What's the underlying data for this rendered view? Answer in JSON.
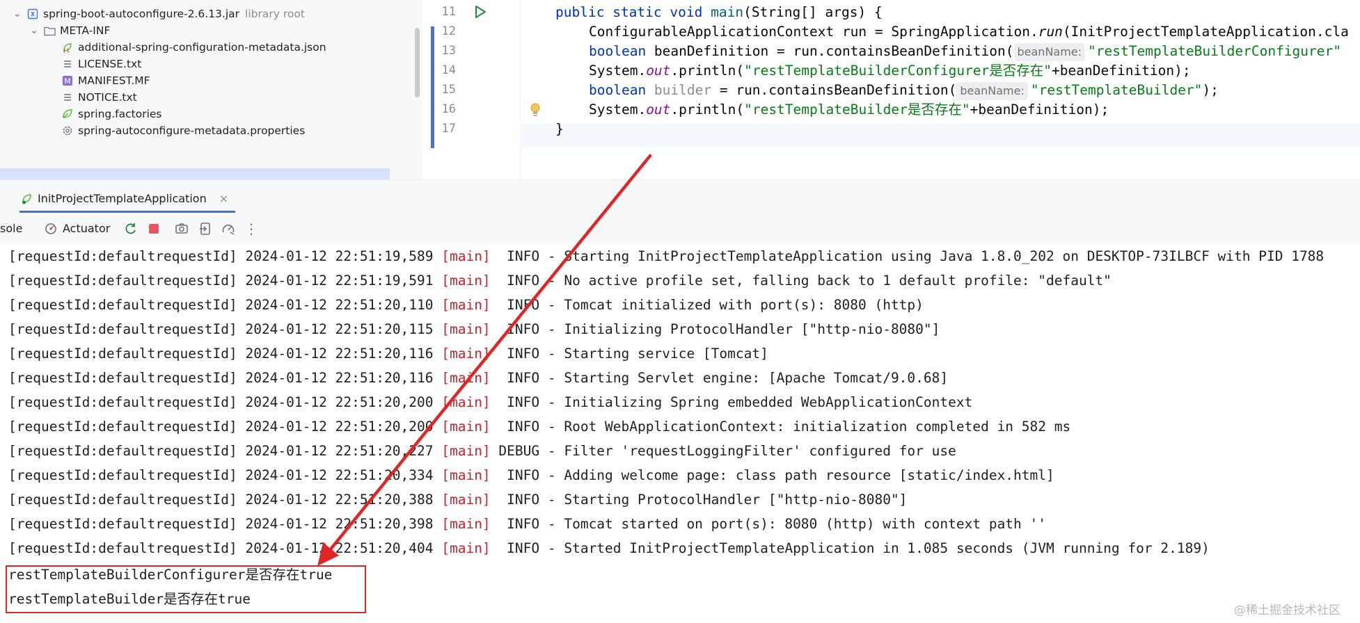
{
  "project_tree": {
    "items": [
      {
        "label": "spring-boot-autoconfigure-2.6.13.jar",
        "secondary": "library root",
        "icon": "jar-archive-icon",
        "expanded": true
      },
      {
        "label": "META-INF",
        "icon": "folder-icon",
        "expanded": true
      },
      {
        "label": "additional-spring-configuration-metadata.json",
        "icon": "spring-json-icon"
      },
      {
        "label": "LICENSE.txt",
        "icon": "text-file-icon"
      },
      {
        "label": "MANIFEST.MF",
        "icon": "manifest-file-icon"
      },
      {
        "label": "NOTICE.txt",
        "icon": "text-file-icon"
      },
      {
        "label": "spring.factories",
        "icon": "spring-leaf-icon"
      },
      {
        "label": "spring-autoconfigure-metadata.properties",
        "icon": "settings-file-icon"
      }
    ]
  },
  "editor": {
    "line_numbers": [
      "11",
      "12",
      "13",
      "14",
      "15",
      "16",
      "17"
    ],
    "line_11": {
      "kw1": "public",
      "kw2": "static",
      "kw3": "void",
      "name": "main",
      "rest": "(String[] args) {"
    },
    "line_12": {
      "a": "ConfigurableApplicationContext run = SpringApplication.",
      "b": "run",
      "c": "(InitProjectTemplateApplication.cla"
    },
    "line_13": {
      "kw": "boolean",
      "a": " beanDefinition = run.containsBeanDefinition(",
      "hint": "beanName:",
      "str": "\"restTemplateBuilderConfigurer\""
    },
    "line_14": {
      "a": "System.",
      "b": "out",
      "c": ".println(",
      "str": "\"restTemplateBuilderConfigurer是否存在\"",
      "d": "+beanDefinition);"
    },
    "line_15": {
      "kw": "boolean",
      "a": " builder",
      "b": " = run.containsBeanDefinition(",
      "hint": "beanName:",
      "str": "\"restTemplateBuilder\"",
      "c": ");"
    },
    "line_16": {
      "a": "System.",
      "b": "out",
      "c": ".println(",
      "str": "\"restTemplateBuilder是否存在\"",
      "d": "+beanDefinition);"
    },
    "line_17": {
      "a": "}"
    }
  },
  "run_window": {
    "tab_label": "InitProjectTemplateApplication",
    "toolbar": {
      "console_label": "sole",
      "actuator_label": "Actuator"
    }
  },
  "console": {
    "log_lines": [
      {
        "prefix": "[requestId:defaultrequestId] 2024-01-12 22:51:19,589 ",
        "thread": "[main]",
        "msg": "  INFO - Starting InitProjectTemplateApplication using Java 1.8.0_202 on DESKTOP-73ILBCF with PID 1788"
      },
      {
        "prefix": "[requestId:defaultrequestId] 2024-01-12 22:51:19,591 ",
        "thread": "[main]",
        "msg": "  INFO - No active profile set, falling back to 1 default profile: \"default\""
      },
      {
        "prefix": "[requestId:defaultrequestId] 2024-01-12 22:51:20,110 ",
        "thread": "[main]",
        "msg": "  INFO - Tomcat initialized with port(s): 8080 (http)"
      },
      {
        "prefix": "[requestId:defaultrequestId] 2024-01-12 22:51:20,115 ",
        "thread": "[main]",
        "msg": "  INFO - Initializing ProtocolHandler [\"http-nio-8080\"]"
      },
      {
        "prefix": "[requestId:defaultrequestId] 2024-01-12 22:51:20,116 ",
        "thread": "[main]",
        "msg": "  INFO - Starting service [Tomcat]"
      },
      {
        "prefix": "[requestId:defaultrequestId] 2024-01-12 22:51:20,116 ",
        "thread": "[main]",
        "msg": "  INFO - Starting Servlet engine: [Apache Tomcat/9.0.68]"
      },
      {
        "prefix": "[requestId:defaultrequestId] 2024-01-12 22:51:20,200 ",
        "thread": "[main]",
        "msg": "  INFO - Initializing Spring embedded WebApplicationContext"
      },
      {
        "prefix": "[requestId:defaultrequestId] 2024-01-12 22:51:20,200 ",
        "thread": "[main]",
        "msg": "  INFO - Root WebApplicationContext: initialization completed in 582 ms"
      },
      {
        "prefix": "[requestId:defaultrequestId] 2024-01-12 22:51:20,227 ",
        "thread": "[main]",
        "msg": " DEBUG - Filter 'requestLoggingFilter' configured for use"
      },
      {
        "prefix": "[requestId:defaultrequestId] 2024-01-12 22:51:20,334 ",
        "thread": "[main]",
        "msg": "  INFO - Adding welcome page: class path resource [static/index.html]"
      },
      {
        "prefix": "[requestId:defaultrequestId] 2024-01-12 22:51:20,388 ",
        "thread": "[main]",
        "msg": "  INFO - Starting ProtocolHandler [\"http-nio-8080\"]"
      },
      {
        "prefix": "[requestId:defaultrequestId] 2024-01-12 22:51:20,398 ",
        "thread": "[main]",
        "msg": "  INFO - Tomcat started on port(s): 8080 (http) with context path ''"
      },
      {
        "prefix": "[requestId:defaultrequestId] 2024-01-12 22:51:20,404 ",
        "thread": "[main]",
        "msg": "  INFO - Started InitProjectTemplateApplication in 1.085 seconds (JVM running for 2.189)"
      }
    ],
    "output_lines": [
      "restTemplateBuilderConfigurer是否存在true",
      "restTemplateBuilder是否存在true"
    ]
  },
  "watermark": "@稀土掘金技术社区",
  "colors": {
    "keyword": "#0033b3",
    "string": "#067d17",
    "thread": "#c8222b",
    "annotation_red": "#e02525",
    "accent": "#3574f0"
  }
}
